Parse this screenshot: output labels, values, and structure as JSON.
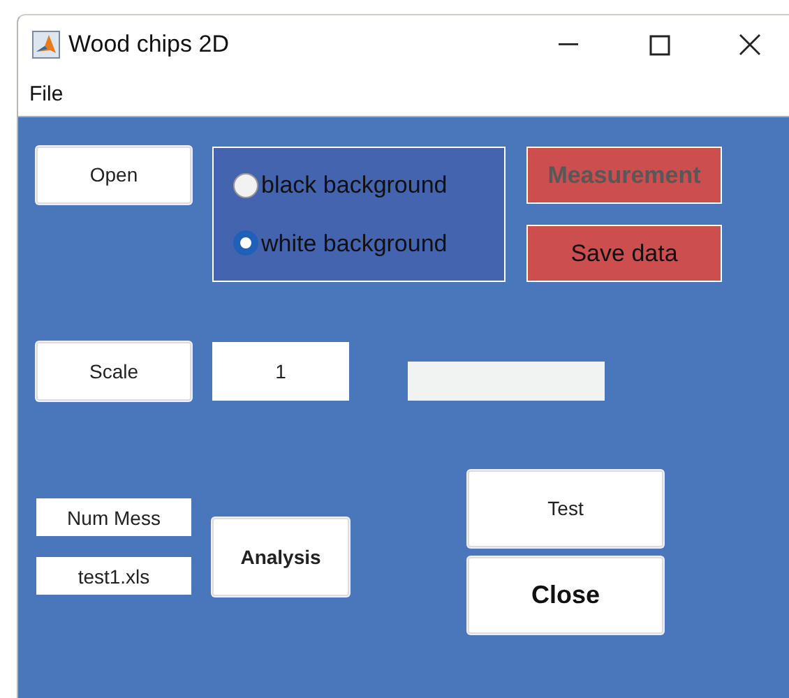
{
  "window": {
    "title": "Wood chips 2D"
  },
  "menu": [
    "File"
  ],
  "buttons": {
    "open": "Open",
    "measurement": {
      "label": "Measurement",
      "disabled": true
    },
    "save": {
      "label": "Save data",
      "disabled": false
    },
    "scale": "Scale",
    "analysis": "Analysis",
    "test": "Test",
    "close": "Close"
  },
  "background_options": [
    {
      "label": "black background",
      "selected": false
    },
    {
      "label": "white background",
      "selected": true
    }
  ],
  "scale_value": "1",
  "num_mess": "Num Mess",
  "file_name": "test1.xls"
}
